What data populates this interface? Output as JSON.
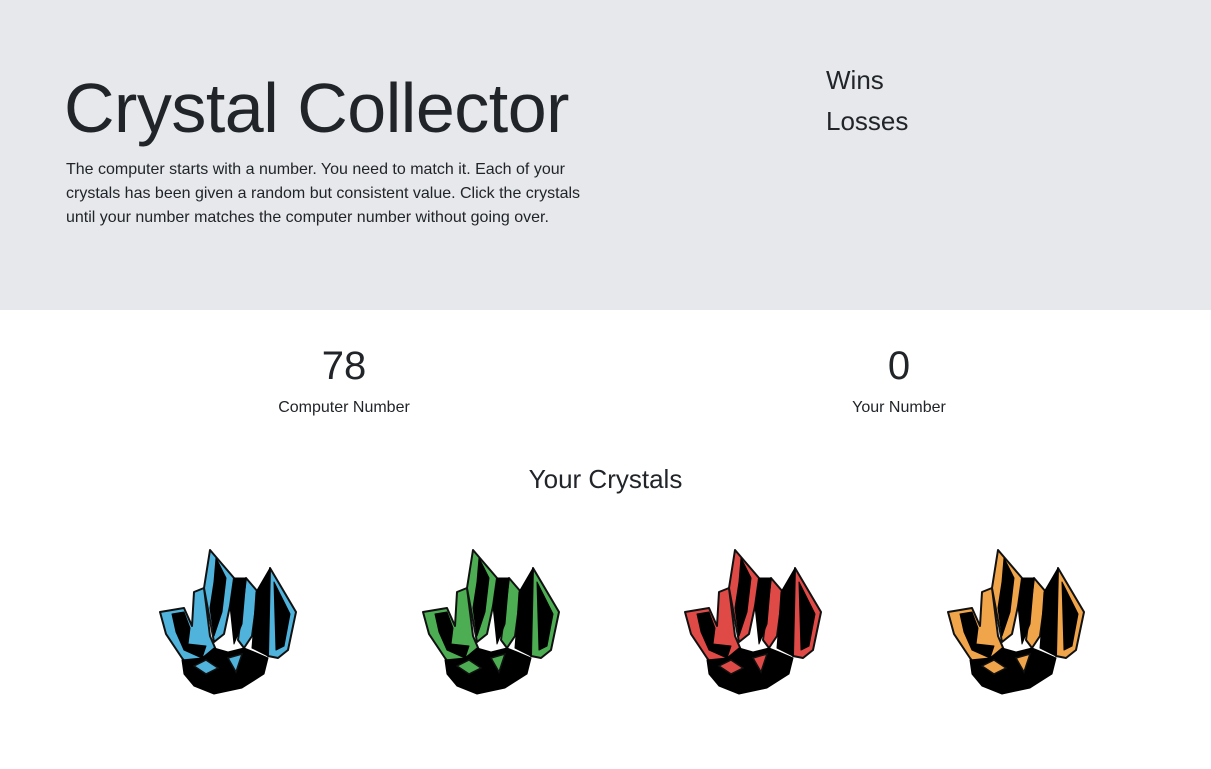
{
  "header": {
    "title": "Crystal Collector",
    "instructions": "The computer starts with a number. You need to match it. Each of your crystals has been given a random but consistent value. Click the crystals until your number matches the computer number without going over.",
    "wins_label": "Wins",
    "losses_label": "Losses"
  },
  "scores": {
    "computer_number": "78",
    "computer_label": "Computer Number",
    "your_number": "0",
    "your_label": "Your Number"
  },
  "crystals": {
    "heading": "Your Crystals",
    "items": [
      {
        "name": "blue-crystal",
        "color": "#4fb3dc"
      },
      {
        "name": "green-crystal",
        "color": "#4cad52"
      },
      {
        "name": "red-crystal",
        "color": "#df4a46"
      },
      {
        "name": "orange-crystal",
        "color": "#f0a54a"
      }
    ]
  }
}
